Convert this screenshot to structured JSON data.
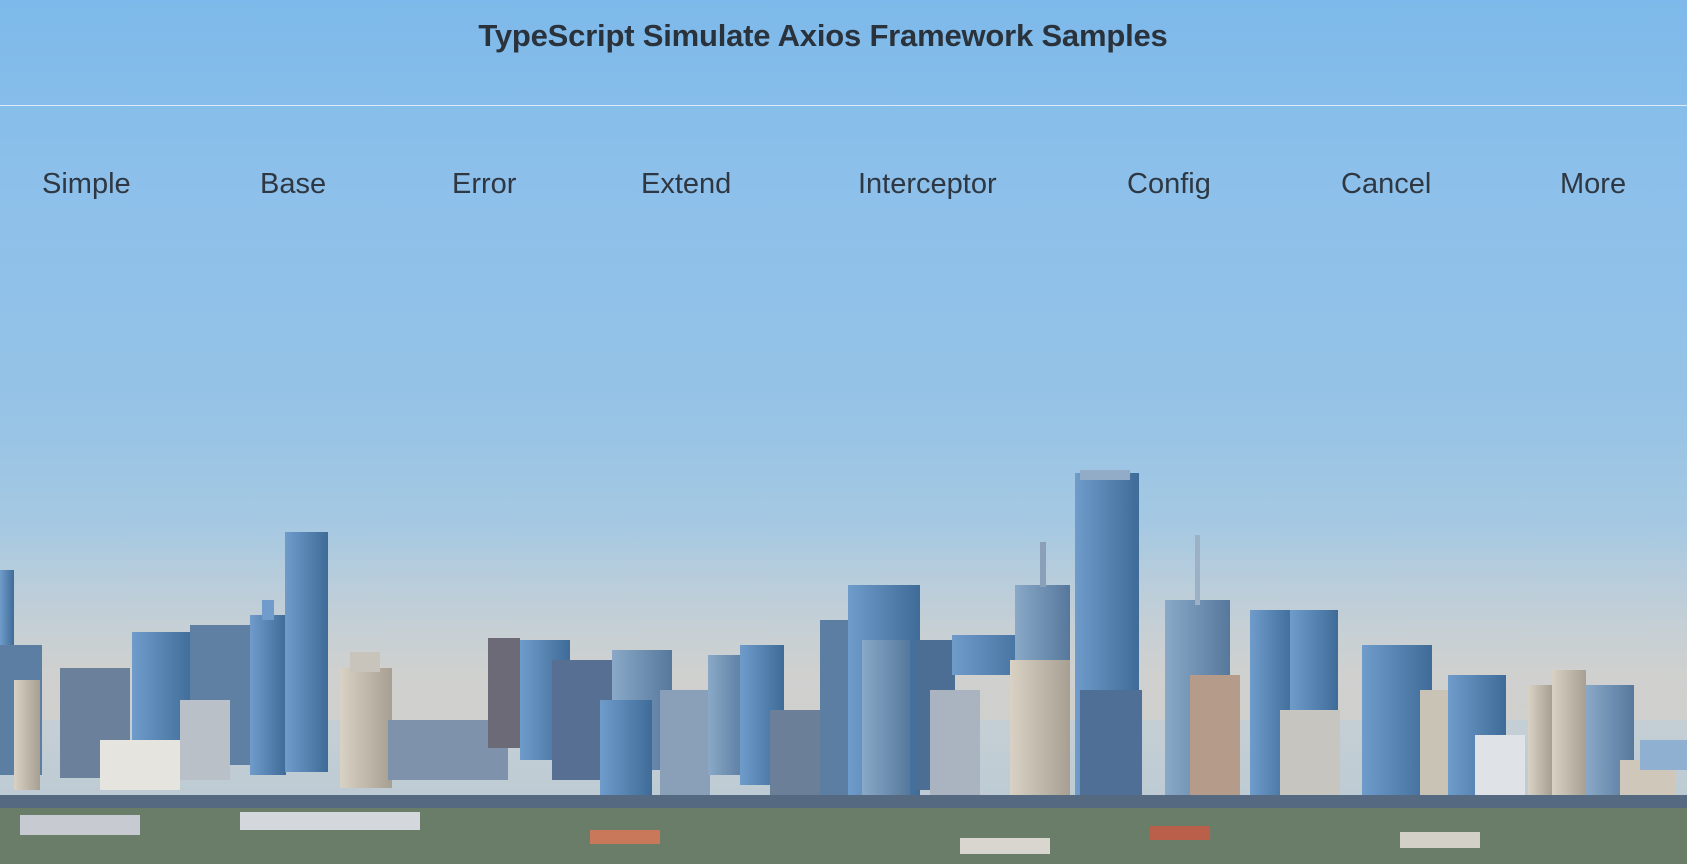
{
  "header": {
    "title": "TypeScript Simulate Axios Framework Samples"
  },
  "nav": {
    "items": [
      {
        "label": "Simple"
      },
      {
        "label": "Base"
      },
      {
        "label": "Error"
      },
      {
        "label": "Extend"
      },
      {
        "label": "Interceptor"
      },
      {
        "label": "Config"
      },
      {
        "label": "Cancel"
      },
      {
        "label": "More"
      }
    ]
  },
  "background": {
    "image": "city-skyline-photo",
    "sky_top_color": "#7db9ea",
    "sky_horizon_color": "#c9d2d6",
    "building_color": "#4f79a6"
  }
}
